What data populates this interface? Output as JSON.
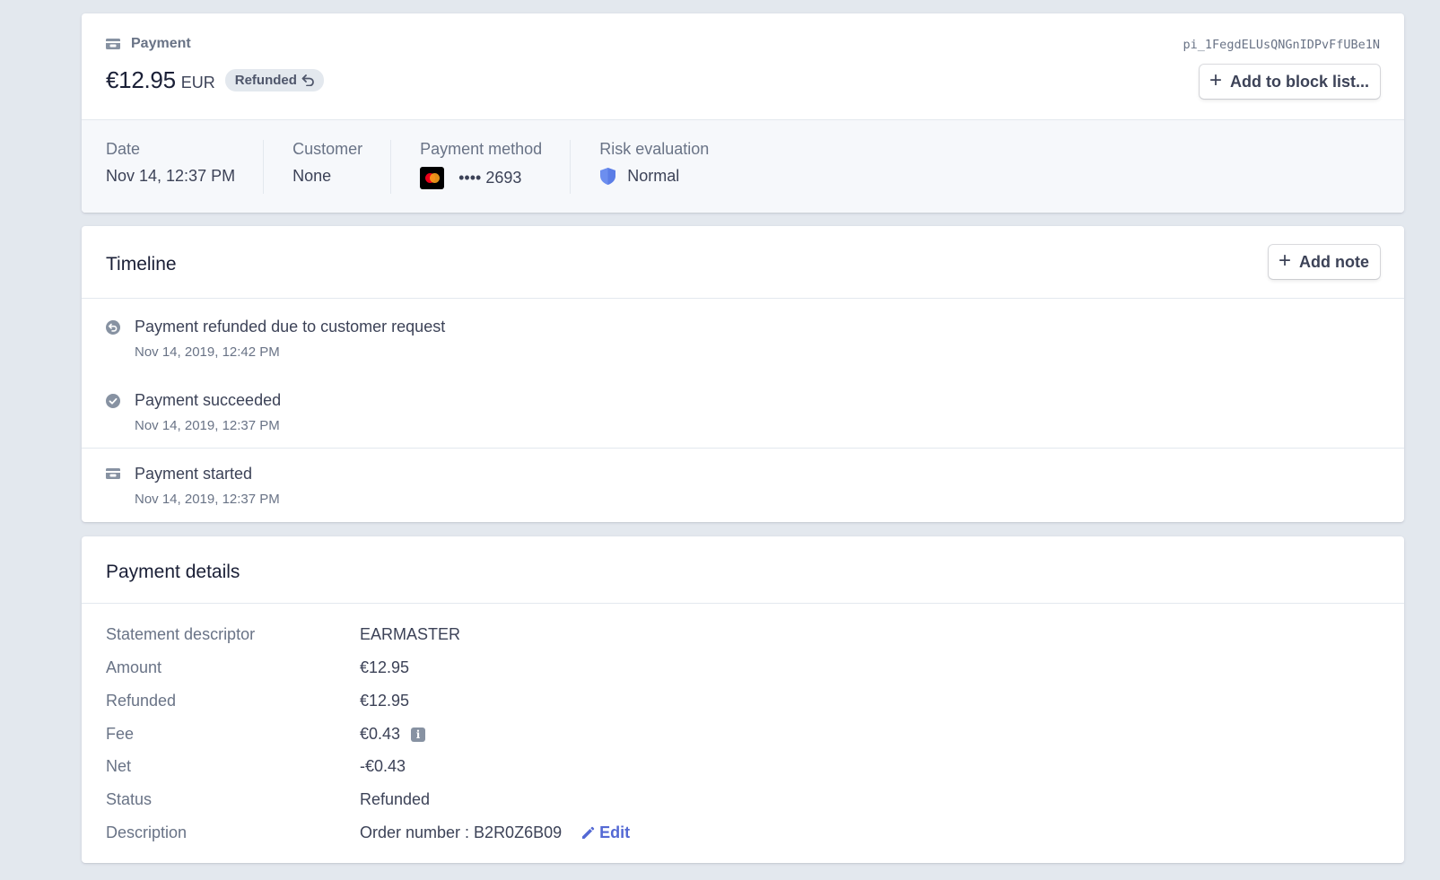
{
  "payment": {
    "label": "Payment",
    "icon": "wallet-icon",
    "amount": "€12.95",
    "currency": "EUR",
    "status_badge": "Refunded",
    "id": "pi_1FegdELUsQNGnIDPvFfUBe1N",
    "block_button": "Add to block list..."
  },
  "meta": {
    "date_label": "Date",
    "date_value": "Nov 14, 12:37 PM",
    "customer_label": "Customer",
    "customer_value": "None",
    "method_label": "Payment method",
    "method_value": "•••• 2693",
    "risk_label": "Risk evaluation",
    "risk_value": "Normal"
  },
  "timeline": {
    "title": "Timeline",
    "add_note": "Add note",
    "events": [
      {
        "title": "Payment refunded due to customer request",
        "time": "Nov 14, 2019, 12:42 PM",
        "icon": "refund-icon"
      },
      {
        "title": "Payment succeeded",
        "time": "Nov 14, 2019, 12:37 PM",
        "icon": "check-circle-icon"
      },
      {
        "title": "Payment started",
        "time": "Nov 14, 2019, 12:37 PM",
        "icon": "wallet-icon"
      }
    ]
  },
  "details": {
    "title": "Payment details",
    "rows": [
      {
        "label": "Statement descriptor",
        "value": "EARMASTER"
      },
      {
        "label": "Amount",
        "value": "€12.95"
      },
      {
        "label": "Refunded",
        "value": "€12.95"
      },
      {
        "label": "Fee",
        "value": "€0.43"
      },
      {
        "label": "Net",
        "value": "-€0.43"
      },
      {
        "label": "Status",
        "value": "Refunded"
      },
      {
        "label": "Description",
        "value": "Order number : B2R0Z6B09"
      }
    ],
    "edit_label": "Edit"
  },
  "colors": {
    "background": "#e3e8ee",
    "accent": "#5469d4",
    "shield": "#6c8eef"
  }
}
